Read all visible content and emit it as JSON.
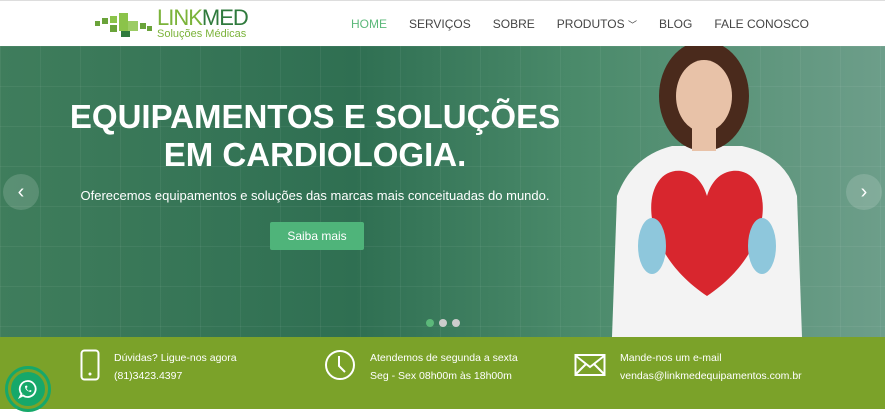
{
  "logo": {
    "title_a": "LINK",
    "title_b": "MED",
    "subtitle": "Soluções Médicas"
  },
  "menu": [
    {
      "label": "HOME",
      "active": true
    },
    {
      "label": "SERVIÇOS"
    },
    {
      "label": "SOBRE"
    },
    {
      "label": "PRODUTOS"
    },
    {
      "label": "BLOG"
    },
    {
      "label": "FALE CONOSCO"
    }
  ],
  "hero": {
    "title_line1": "EQUIPAMENTOS E SOLUÇÕES",
    "title_line2": "EM CARDIOLOGIA.",
    "subtitle": "Oferecemos equipamentos e soluções das marcas mais conceituadas do mundo.",
    "button": "Saiba mais",
    "slides": 3,
    "active_slide": 0
  },
  "contact": [
    {
      "icon": "phone-icon",
      "title": "Dúvidas? Ligue-nos agora",
      "value": "(81)3423.4397"
    },
    {
      "icon": "clock-icon",
      "title": "Atendemos de segunda a sexta",
      "value": "Seg - Sex 08h00m às 18h00m"
    },
    {
      "icon": "mail-icon",
      "title": "Mande-nos um e-mail",
      "value": "vendas@linkmedequipamentos.com.br"
    }
  ],
  "colors": {
    "accent": "#5cb87a",
    "bar": "#7ba229",
    "whatsapp": "#16a86a"
  }
}
